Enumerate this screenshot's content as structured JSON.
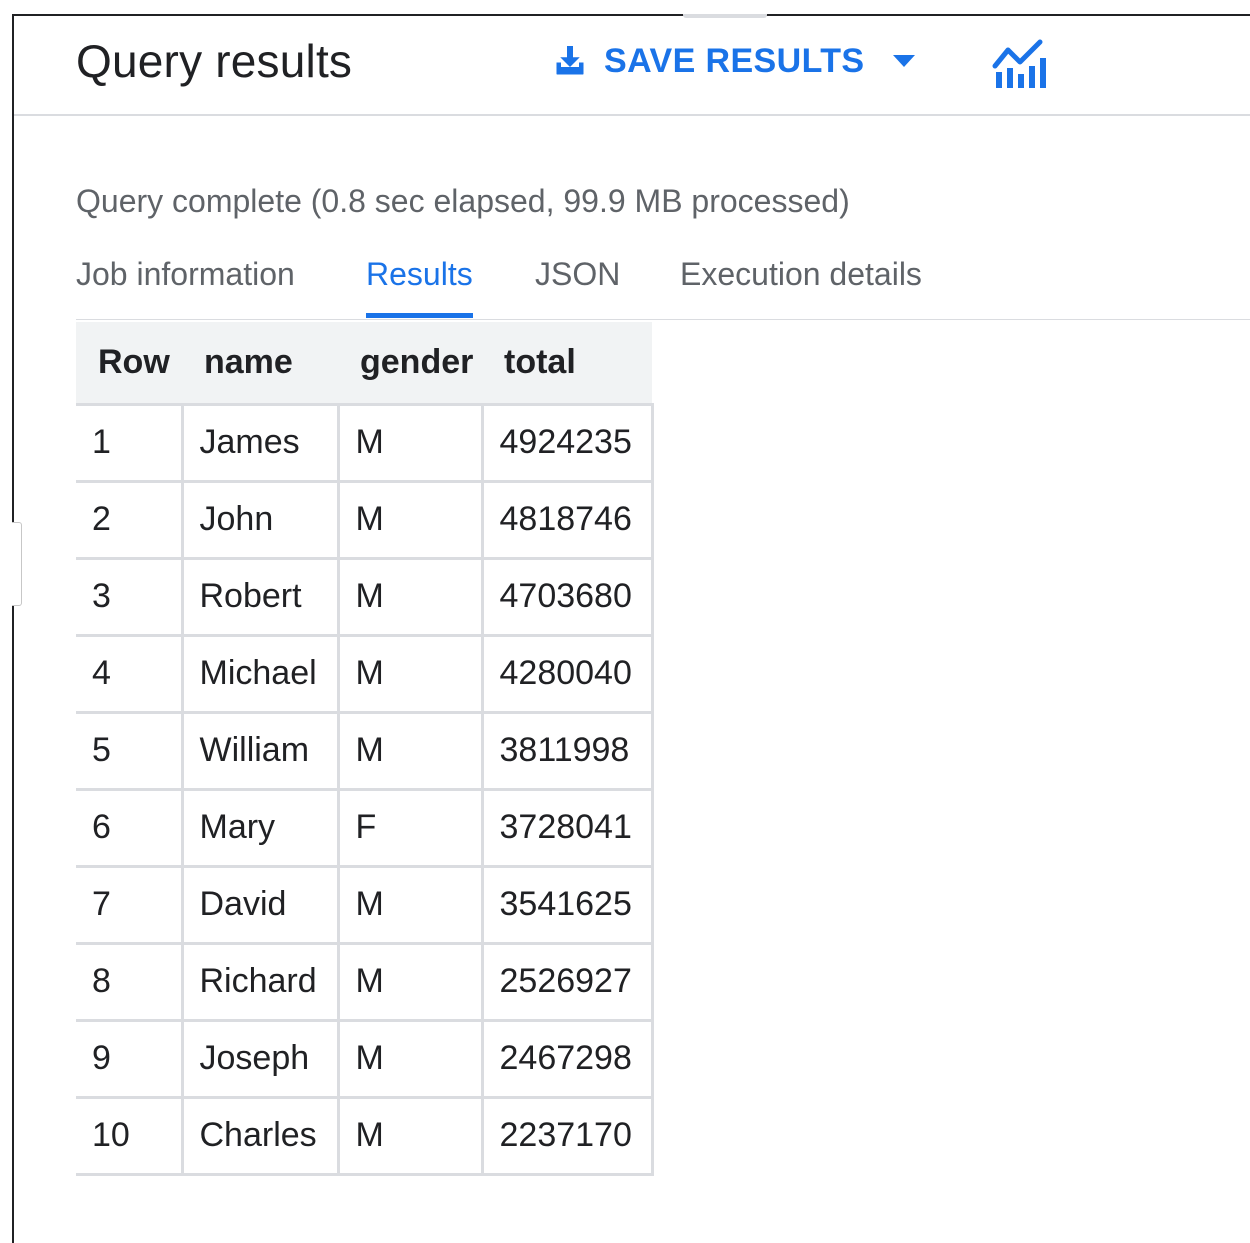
{
  "header": {
    "title": "Query results",
    "save_label": "SAVE RESULTS",
    "accent_color": "#1a73e8",
    "icons": [
      "download-icon",
      "caret-down-icon",
      "explore-chart-icon"
    ]
  },
  "status": {
    "text": "Query complete (0.8 sec elapsed, 99.9 MB processed)"
  },
  "tabs": [
    {
      "label": "Job information",
      "active": false
    },
    {
      "label": "Results",
      "active": true
    },
    {
      "label": "JSON",
      "active": false
    },
    {
      "label": "Execution details",
      "active": false
    }
  ],
  "table": {
    "columns": [
      "Row",
      "name",
      "gender",
      "total"
    ],
    "rows": [
      [
        "1",
        "James",
        "M",
        "4924235"
      ],
      [
        "2",
        "John",
        "M",
        "4818746"
      ],
      [
        "3",
        "Robert",
        "M",
        "4703680"
      ],
      [
        "4",
        "Michael",
        "M",
        "4280040"
      ],
      [
        "5",
        "William",
        "M",
        "3811998"
      ],
      [
        "6",
        "Mary",
        "F",
        "3728041"
      ],
      [
        "7",
        "David",
        "M",
        "3541625"
      ],
      [
        "8",
        "Richard",
        "M",
        "2526927"
      ],
      [
        "9",
        "Joseph",
        "M",
        "2467298"
      ],
      [
        "10",
        "Charles",
        "M",
        "2237170"
      ]
    ]
  }
}
